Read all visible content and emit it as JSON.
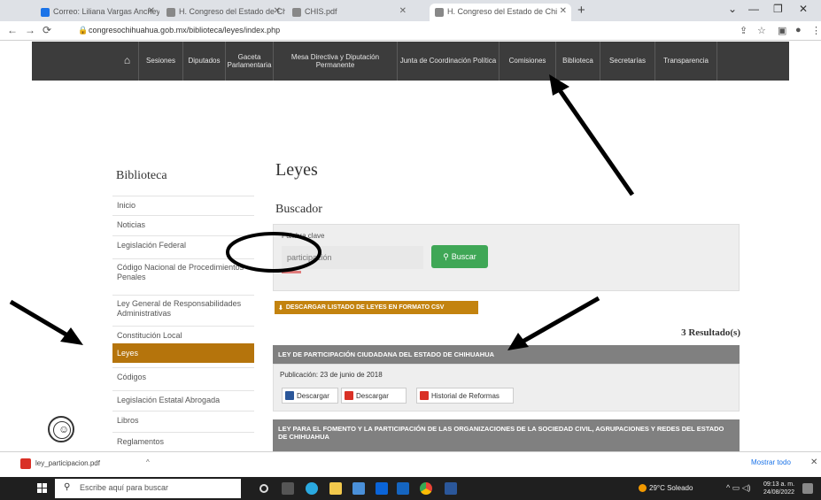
{
  "browser": {
    "tabs": [
      {
        "label": "Correo: Liliana Vargas Ancheyta",
        "color": "#1a73e8"
      },
      {
        "label": "H. Congreso del Estado de Chi",
        "color": "#888888"
      },
      {
        "label": "CHIS.pdf",
        "color": "#888888"
      },
      {
        "label": "H. Congreso del Estado de Chi",
        "color": "#888888"
      }
    ],
    "new_tab": "+",
    "window_controls": [
      "⌄",
      "—",
      "❐",
      "✕"
    ],
    "nav": {
      "back": "←",
      "forward": "→",
      "reload": "⟳"
    },
    "url": "congresochihuahua.gob.mx/biblioteca/leyes/index.php"
  },
  "site_nav": {
    "home_icon": "home-icon",
    "items": [
      {
        "label": "Sesiones"
      },
      {
        "label": "Diputados"
      },
      {
        "label": "Gaceta Parlamentaria"
      },
      {
        "label": "Mesa Directiva y Diputación Permanente"
      },
      {
        "label": "Junta de Coordinación Política"
      },
      {
        "label": "Comisiones"
      },
      {
        "label": "Biblioteca"
      },
      {
        "label": "Secretarías"
      },
      {
        "label": "Transparencia"
      }
    ]
  },
  "sidebar": {
    "title": "Biblioteca",
    "items": [
      {
        "label": "Inicio"
      },
      {
        "label": "Noticias"
      },
      {
        "label": "Legislación Federal"
      },
      {
        "label": "Código Nacional de Procedimientos Penales"
      },
      {
        "label": "Ley General de Responsabilidades Administrativas"
      },
      {
        "label": "Constitución Local"
      },
      {
        "label": "Leyes"
      },
      {
        "label": "Códigos"
      },
      {
        "label": "Legislación Estatal Abrogada"
      },
      {
        "label": "Libros"
      },
      {
        "label": "Reglamentos"
      }
    ]
  },
  "main": {
    "title": "Leyes",
    "search_heading": "Buscador",
    "search_label": "Palabra clave",
    "search_value": "participación",
    "search_button": "Buscar",
    "download_list": "DESCARGAR LISTADO DE LEYES EN FORMATO CSV",
    "results_count": "3 Resultado(s)",
    "results": [
      {
        "title": "LEY DE PARTICIPACIÓN CIUDADANA DEL ESTADO DE CHIHUAHUA",
        "publication": "Publicación: 23 de junio de 2018",
        "actions": [
          {
            "label": "Descargar",
            "color": "#2b579a"
          },
          {
            "label": "Descargar",
            "color": "#d93025"
          },
          {
            "label": "Historial de Reformas",
            "color": "#d93025"
          }
        ]
      },
      {
        "title": "LEY PARA EL FOMENTO Y LA PARTICIPACIÓN DE LAS ORGANIZACIONES DE LA SOCIEDAD CIVIL, AGRUPACIONES Y REDES DEL ESTADO DE CHIHUAHUA"
      }
    ]
  },
  "downloads_bar": {
    "file": "ley_participacion.pdf",
    "show_all": "Mostrar todo",
    "close": "✕"
  },
  "taskbar": {
    "search_placeholder": "Escribe aquí para buscar",
    "weather": "29°C Soleado",
    "time": "09:13 a. m.",
    "date": "24/08/2022"
  },
  "colors": {
    "nav_bg": "#3c3c3c",
    "active_item": "#b5740c",
    "buscar": "#3fa756",
    "download": "#c3830f",
    "result_header": "#808080"
  }
}
